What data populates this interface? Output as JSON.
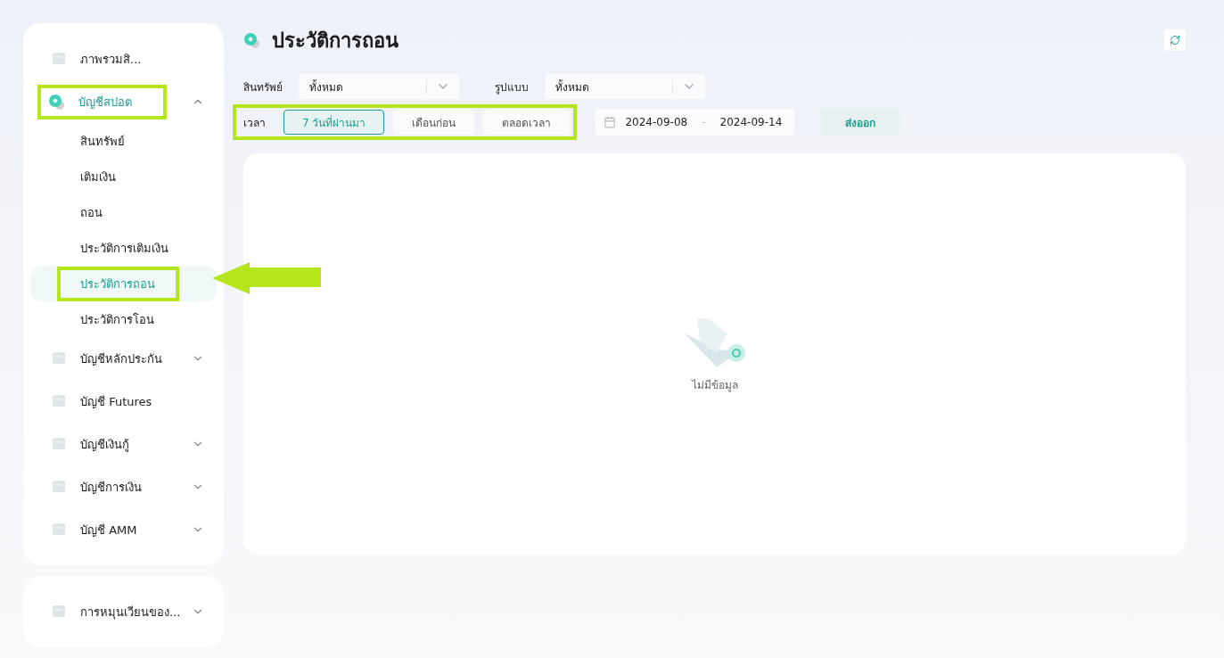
{
  "sidebar": {
    "sections": [
      {
        "items": [
          {
            "label": "ภาพรวมสิ...",
            "kind": "link",
            "selected": false,
            "highlighted": false
          },
          {
            "label": "บัญชีสปอต",
            "kind": "group",
            "selected": true,
            "expanded": true,
            "highlighted": true,
            "children": [
              {
                "label": "สินทรัพย์",
                "selected": false,
                "highlighted": false
              },
              {
                "label": "เติมเงิน",
                "selected": false,
                "highlighted": false
              },
              {
                "label": "ถอน",
                "selected": false,
                "highlighted": false
              },
              {
                "label": "ประวัติการเติมเงิน",
                "selected": false,
                "highlighted": false
              },
              {
                "label": "ประวัติการถอน",
                "selected": true,
                "highlighted": true
              },
              {
                "label": "ประวัติการโอน",
                "selected": false,
                "highlighted": false
              }
            ]
          },
          {
            "label": "บัญชีหลักประกัน",
            "kind": "group",
            "selected": false,
            "expanded": false,
            "highlighted": false
          },
          {
            "label": "บัญชี Futures",
            "kind": "link",
            "selected": false,
            "highlighted": false
          },
          {
            "label": "บัญชีเงินกู้",
            "kind": "group",
            "selected": false,
            "expanded": false,
            "highlighted": false
          },
          {
            "label": "บัญชีการเงิน",
            "kind": "group",
            "selected": false,
            "expanded": false,
            "highlighted": false
          },
          {
            "label": "บัญชี AMM",
            "kind": "group",
            "selected": false,
            "expanded": false,
            "highlighted": false
          }
        ]
      },
      {
        "items": [
          {
            "label": "การหมุนเวียนของ...",
            "kind": "group",
            "selected": false,
            "expanded": false,
            "highlighted": false
          }
        ]
      }
    ]
  },
  "page": {
    "title": "ประวัติการถอน"
  },
  "filters": {
    "selects": [
      {
        "label": "สินทรัพย์",
        "value": "ทั้งหมด"
      },
      {
        "label": "รูปแบบ",
        "value": "ทั้งหมด"
      }
    ],
    "time": {
      "label": "เวลา",
      "highlighted": true,
      "options": [
        {
          "label": "7 วันที่ผ่านมา",
          "selected": true
        },
        {
          "label": "เดือนก่อน",
          "selected": false
        },
        {
          "label": "ตลอดเวลา",
          "selected": false
        }
      ]
    },
    "date_range": {
      "start": "2024-09-08",
      "separator": "-",
      "end": "2024-09-14"
    },
    "export_button": "ส่งออก"
  },
  "empty_state": {
    "message": "ไม่มีข้อมูล"
  }
}
